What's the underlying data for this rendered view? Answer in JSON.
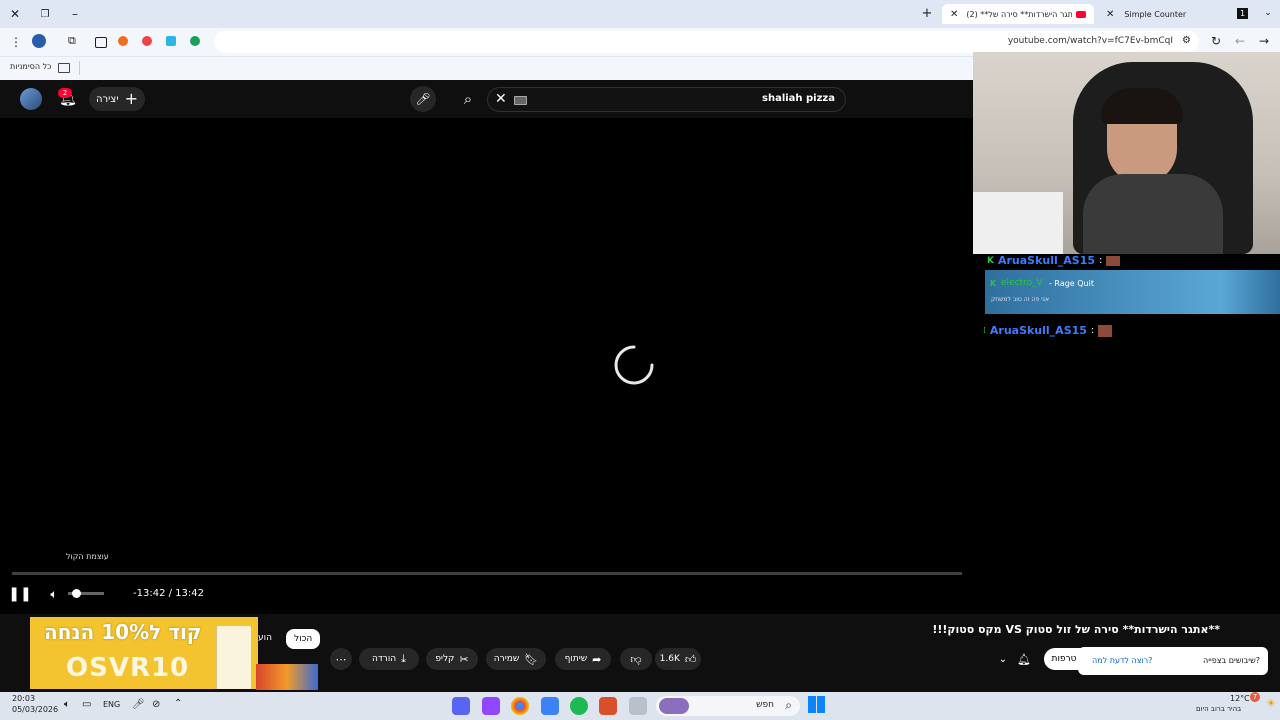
{
  "browser": {
    "tabs": [
      {
        "title": "Simple Counter",
        "active": false
      },
      {
        "title": "(2) **אתגר הישרדות** סירה של",
        "active": true
      }
    ],
    "url": "youtube.com/watch?v=fC7Ev-bmCqI",
    "bookmarks_label": "כל הסימניות"
  },
  "youtube": {
    "search_value": "shaliah pizza",
    "create_label": "יצירה",
    "notification_count": "2"
  },
  "player": {
    "time": "-13:42 / 13:42",
    "tooltip": "עוצמת הקול"
  },
  "video": {
    "title": "**אתגר הישרדות** סירה של זול סטוק VS מקס סטוק!!!",
    "likes": "1.6K",
    "share_label": "שיתוף",
    "save_label": "שמירה",
    "clip_label": "קליפ",
    "download_label": "הורדה",
    "subscribe_label": "טרפות",
    "filter_all": "הכול",
    "filter_related": "הוע"
  },
  "ad": {
    "line1": "קוד ל10% הנחה",
    "line2": "OSVR10"
  },
  "survey": {
    "question": "שיבושים בצפייה?",
    "link": "רוצה לדעת למה?"
  },
  "chat": [
    {
      "user": "AruaSkull_AS15",
      "sep": ":"
    },
    {
      "user": "electro_V",
      "text": "- Rage Quit",
      "sub": "אני פה זה טוב למשחק"
    },
    {
      "user": "AruaSkull_AS15",
      "sep": ":"
    }
  ],
  "taskbar": {
    "time": "20:03",
    "date": "05/03/2026",
    "lang": "ENG",
    "search": "חפש",
    "weather_temp": "12°C",
    "weather_desc": "בהיר ברוב היום",
    "weather_badge": "7"
  },
  "colors": {
    "accent_red": "#ff0033",
    "chat_user": "#3d7bff",
    "ad_yellow": "#f3c42f"
  }
}
